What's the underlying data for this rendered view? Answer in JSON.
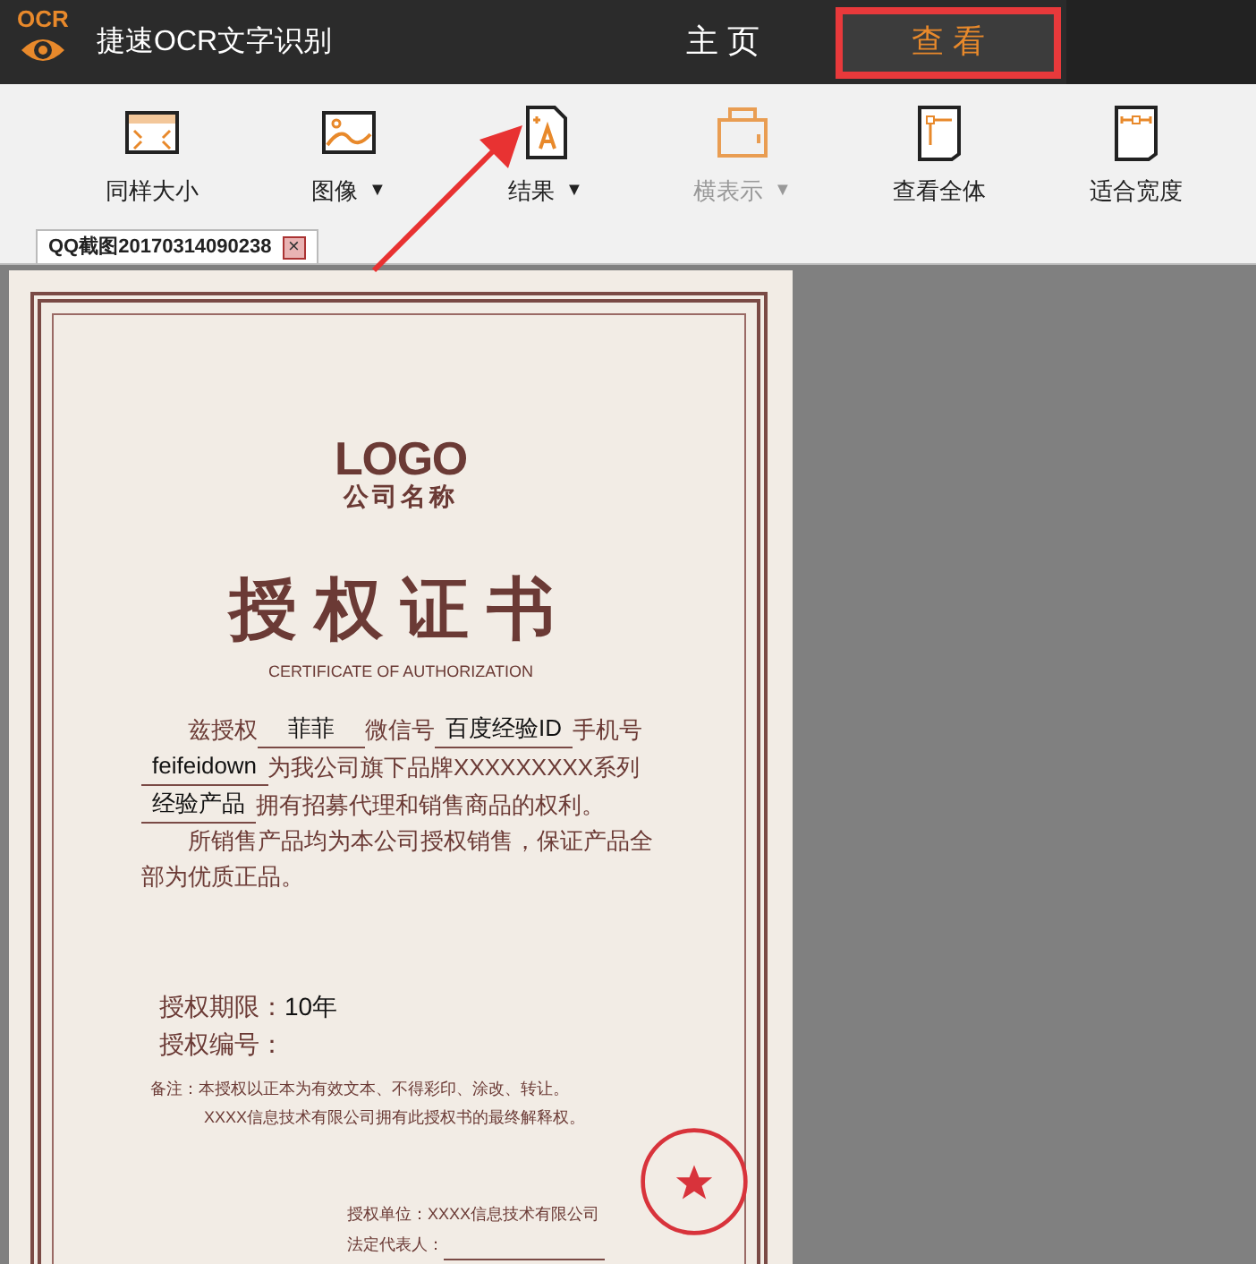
{
  "app": {
    "logo_text": "OCR",
    "title": "捷速OCR文字识别"
  },
  "nav_tabs": [
    {
      "label": "主 页",
      "selected": false
    },
    {
      "label": "查 看",
      "selected": true
    }
  ],
  "toolbar": [
    {
      "label": "同样大小",
      "dropdown": false,
      "disabled": false
    },
    {
      "label": "图像",
      "dropdown": true,
      "disabled": false
    },
    {
      "label": "结果",
      "dropdown": true,
      "disabled": false
    },
    {
      "label": "横表示",
      "dropdown": true,
      "disabled": true
    },
    {
      "label": "查看全体",
      "dropdown": false,
      "disabled": false
    },
    {
      "label": "适合宽度",
      "dropdown": false,
      "disabled": false
    }
  ],
  "dropdown_glyph": "▼",
  "doc_tabs": [
    {
      "label": "QQ截图20170314090238",
      "close": "×",
      "selected": true
    }
  ],
  "certificate": {
    "logo": "LOGO",
    "company": "公司名称",
    "title": "授权证书",
    "subtitle": "CERTIFICATE OF AUTHORIZATION",
    "body": [
      [
        {
          "kind": "text",
          "text": "兹授权"
        },
        {
          "kind": "fill",
          "text": "菲菲"
        },
        {
          "kind": "text",
          "text": "微信号"
        },
        {
          "kind": "fill",
          "text": "百度经验ID"
        },
        {
          "kind": "text",
          "text": "手机号"
        }
      ],
      [
        {
          "kind": "fill",
          "text": "feifeidown"
        },
        {
          "kind": "text",
          "text": "为我公司旗下品牌XXXXXXXXX系列"
        }
      ],
      [
        {
          "kind": "fill",
          "text": "经验产品"
        },
        {
          "kind": "text",
          "text": "拥有招募代理和销售商品的权利。"
        }
      ],
      [
        {
          "kind": "text",
          "text": "所销售产品均为本公司授权销售，保证产品全"
        }
      ],
      [
        {
          "kind": "text",
          "text": "部为优质正品。"
        }
      ]
    ],
    "term_label": "授权期限：",
    "term_value": "10年",
    "number_label": "授权编号：",
    "notes": [
      "备注：本授权以正本为有效文本、不得彩印、涂改、转让。",
      "XXXX信息技术有限公司拥有此授权书的最终解释权。"
    ],
    "issuer": "授权单位：XXXX信息技术有限公司",
    "representative": "法定代表人："
  }
}
